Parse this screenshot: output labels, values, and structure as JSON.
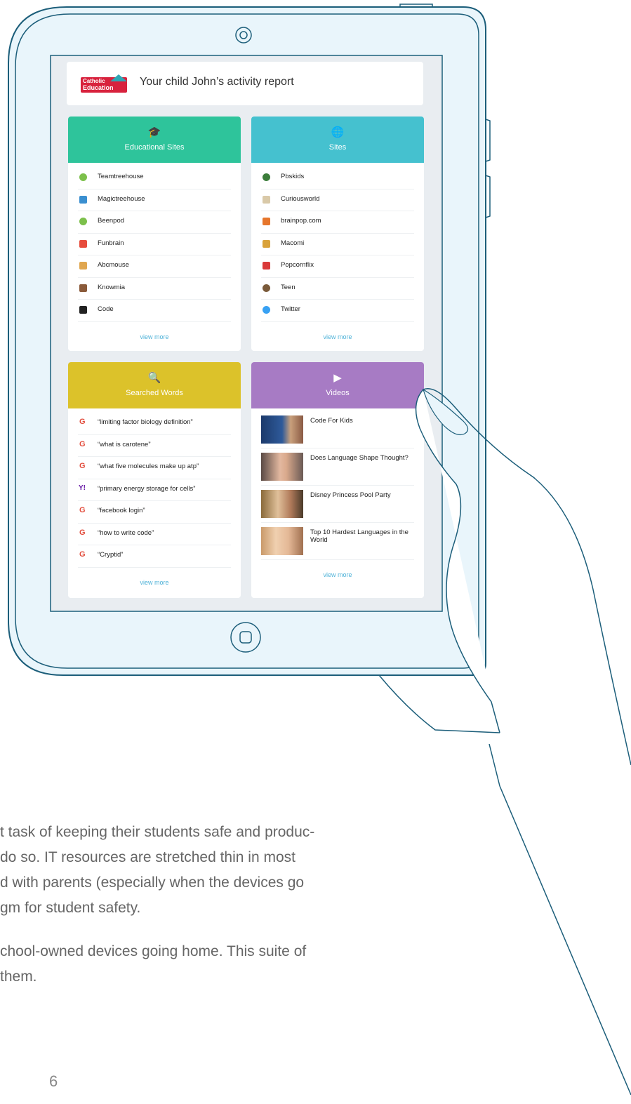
{
  "report": {
    "logo_line1": "Catholic",
    "logo_line2": "Education",
    "title": "Your child John’s activity report"
  },
  "cards": {
    "educational": {
      "title": "Educational Sites",
      "icon": "graduation-cap-icon",
      "color": "#2ec49b",
      "items": [
        "Teamtreehouse",
        "Magictreehouse",
        "Beenpod",
        "Funbrain",
        "Abcmouse",
        "Knowmia",
        "Code"
      ],
      "view_more": "view more"
    },
    "sites": {
      "title": "Sites",
      "icon": "globe-icon",
      "color": "#45c1cf",
      "items": [
        "Pbskids",
        "Curiousworld",
        "brainpop.com",
        "Macomi",
        "Popcornflix",
        "Teen",
        "Twitter"
      ],
      "view_more": "view more"
    },
    "searched": {
      "title": "Searched Words",
      "icon": "search-icon",
      "color": "#dcc22a",
      "items": [
        "“limiting factor biology definition”",
        "“what is carotene”",
        "“what five molecules make up atp”",
        "“primary energy storage for cells”",
        "“facebook login”",
        "“how to write code”",
        "“Cryptid”"
      ],
      "view_more": "view more"
    },
    "videos": {
      "title": "Videos",
      "icon": "play-icon",
      "color": "#a77bc4",
      "items": [
        "Code For Kids",
        "Does Language Shape Thought?",
        "Disney Princess Pool Party",
        "Top 10 Hardest Languages in the World"
      ],
      "view_more": "view more"
    }
  },
  "body_text": {
    "line1": "t task of keeping their students safe and produc-",
    "line2": " do so. IT resources are stretched thin in most",
    "line3": "d with parents (especially when the devices go",
    "line4": "gm for student safety.",
    "line5": "chool-owned devices going home. This suite of",
    "line6": "them."
  },
  "page_number": "6"
}
